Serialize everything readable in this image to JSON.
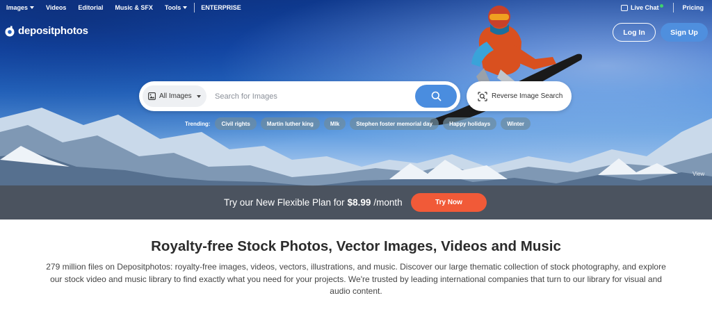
{
  "nav": {
    "items": [
      {
        "label": "Images",
        "has_caret": true
      },
      {
        "label": "Videos",
        "has_caret": false
      },
      {
        "label": "Editorial",
        "has_caret": false
      },
      {
        "label": "Music & SFX",
        "has_caret": false
      },
      {
        "label": "Tools",
        "has_caret": true
      },
      {
        "label": "ENTERPRISE",
        "has_caret": false
      }
    ],
    "live_chat": "Live Chat",
    "pricing": "Pricing"
  },
  "logo": {
    "text": "depositphotos"
  },
  "auth": {
    "login": "Log In",
    "signup": "Sign Up"
  },
  "search": {
    "type_selected": "All Images",
    "placeholder": "Search for Images",
    "reverse_label": "Reverse Image Search"
  },
  "trending": {
    "label": "Trending:",
    "chips": [
      "Civil rights",
      "Martin luther king",
      "Mlk",
      "Stephen foster memorial day",
      "Happy holidays",
      "Winter"
    ]
  },
  "view_link": "View",
  "promo": {
    "text_before": "Try our New Flexible Plan for",
    "price": "$8.99",
    "text_after": "/month",
    "button": "Try Now"
  },
  "content": {
    "headline": "Royalty-free Stock Photos, Vector Images, Videos and Music",
    "description": "279 million files on Depositphotos: royalty-free images, videos, vectors, illustrations, and music. Discover our large thematic collection of stock photography, and explore our stock video and music library to find exactly what you need for your projects. We're trusted by leading international companies that turn to our library for visual and audio content."
  },
  "colors": {
    "accent_blue": "#4a8ddf",
    "try_now_orange": "#f15a38",
    "online_green": "#3fd16d"
  },
  "icons": [
    "logo-icon",
    "chat-icon",
    "image-icon",
    "search-icon",
    "reverse-search-icon",
    "chevron-down-icon"
  ]
}
